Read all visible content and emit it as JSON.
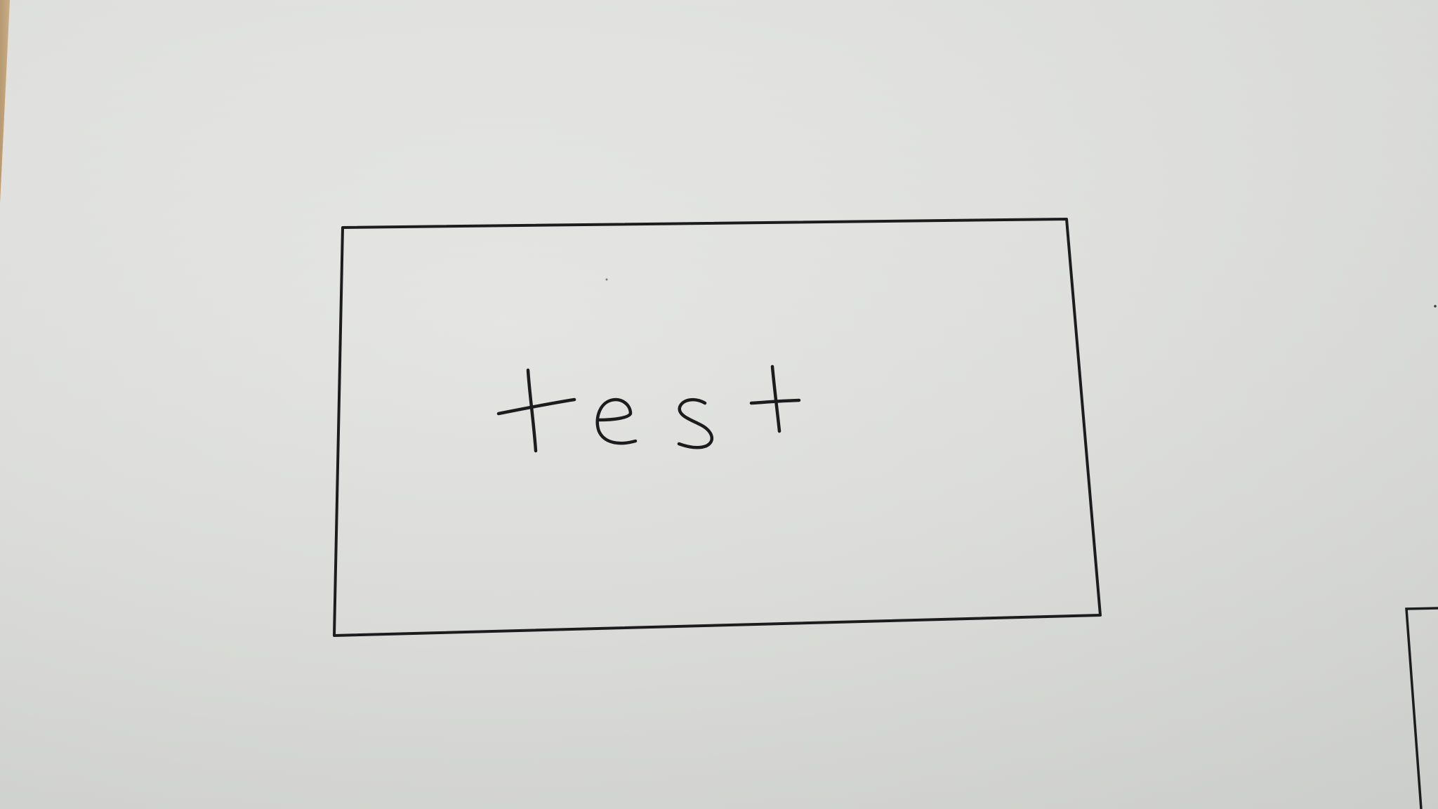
{
  "handwritten_text": "test",
  "colors": {
    "paper": "#e2e3e0",
    "ink": "#1c1c1e",
    "table": "#c8ae88"
  }
}
